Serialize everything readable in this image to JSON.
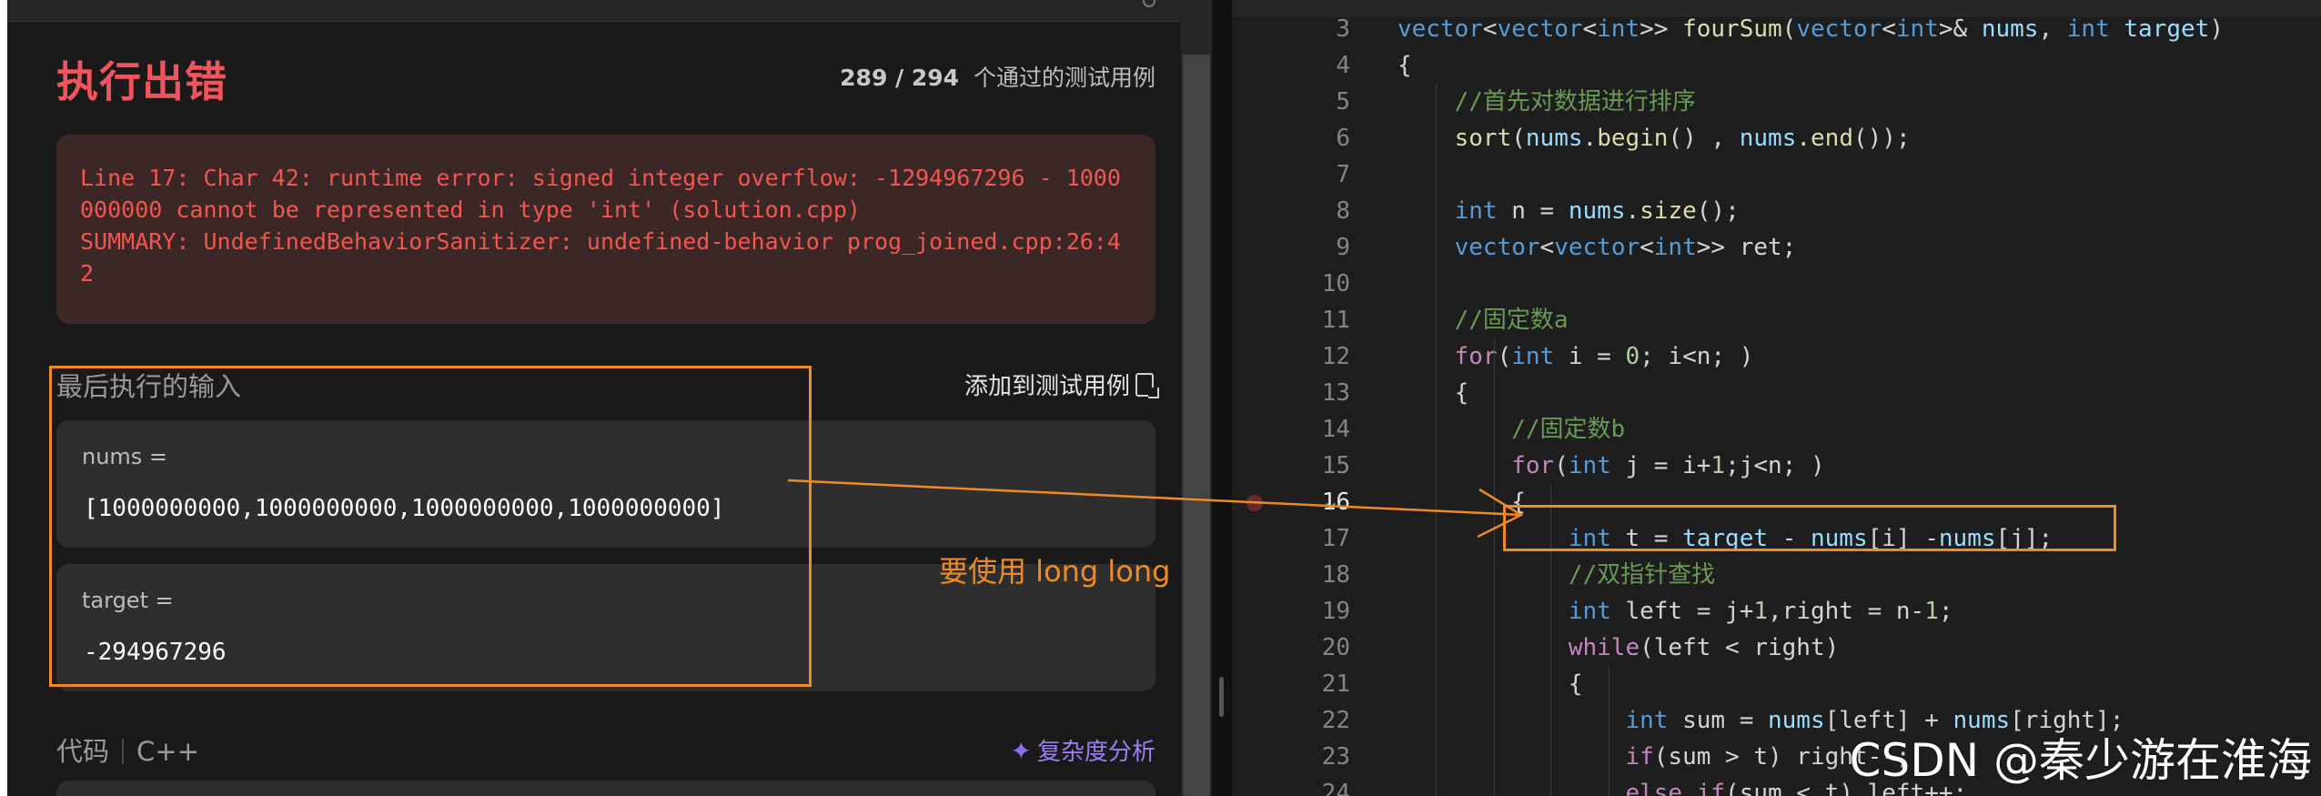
{
  "left_panel": {
    "result_title": "执行出错",
    "passed": {
      "count": "289 / 294",
      "suffix": "个通过的测试用例"
    },
    "error_text": "Line 17: Char 42: runtime error: signed integer overflow: -1294967296 - 1000000000 cannot be represented in type 'int' (solution.cpp)\nSUMMARY: UndefinedBehaviorSanitizer: undefined-behavior prog_joined.cpp:26:42",
    "last_input_label": "最后执行的输入",
    "add_testcase_label": "添加到测试用例",
    "inputs": [
      {
        "label": "nums =",
        "value": "[1000000000,1000000000,1000000000,1000000000]"
      },
      {
        "label": "target =",
        "value": "-294967296"
      }
    ],
    "code_label": "代码",
    "language": "C++",
    "complexity_label": "复杂度分析"
  },
  "annotation": {
    "text": "要使用 long long",
    "color": "#f08a24"
  },
  "editor": {
    "active_line": 16,
    "lines": [
      {
        "no": "3",
        "text": "vector<vector<int>> fourSum(vector<int>& nums, int target)"
      },
      {
        "no": "4",
        "text": "{"
      },
      {
        "no": "5",
        "text": "    //首先对数据进行排序"
      },
      {
        "no": "6",
        "text": "    sort(nums.begin() , nums.end());"
      },
      {
        "no": "7",
        "text": ""
      },
      {
        "no": "8",
        "text": "    int n = nums.size();"
      },
      {
        "no": "9",
        "text": "    vector<vector<int>> ret;"
      },
      {
        "no": "10",
        "text": ""
      },
      {
        "no": "11",
        "text": "    //固定数a"
      },
      {
        "no": "12",
        "text": "    for(int i = 0; i<n; )"
      },
      {
        "no": "13",
        "text": "    {"
      },
      {
        "no": "14",
        "text": "        //固定数b"
      },
      {
        "no": "15",
        "text": "        for(int j = i+1;j<n; )"
      },
      {
        "no": "16",
        "text": "        {"
      },
      {
        "no": "17",
        "text": "            int t = target - nums[i] -nums[j];"
      },
      {
        "no": "18",
        "text": "            //双指针查找"
      },
      {
        "no": "19",
        "text": "            int left = j+1,right = n-1;"
      },
      {
        "no": "20",
        "text": "            while(left < right)"
      },
      {
        "no": "21",
        "text": "            {"
      },
      {
        "no": "22",
        "text": "                int sum = nums[left] + nums[right];"
      },
      {
        "no": "23",
        "text": "                if(sum > t) right--;"
      },
      {
        "no": "24",
        "text": "                else if(sum < t) left++;"
      }
    ]
  },
  "watermark": "CSDN @秦少游在淮海",
  "colors": {
    "error": "#f0555e",
    "accent_orange": "#f08a24",
    "complexity_purple": "#9b7df5"
  }
}
